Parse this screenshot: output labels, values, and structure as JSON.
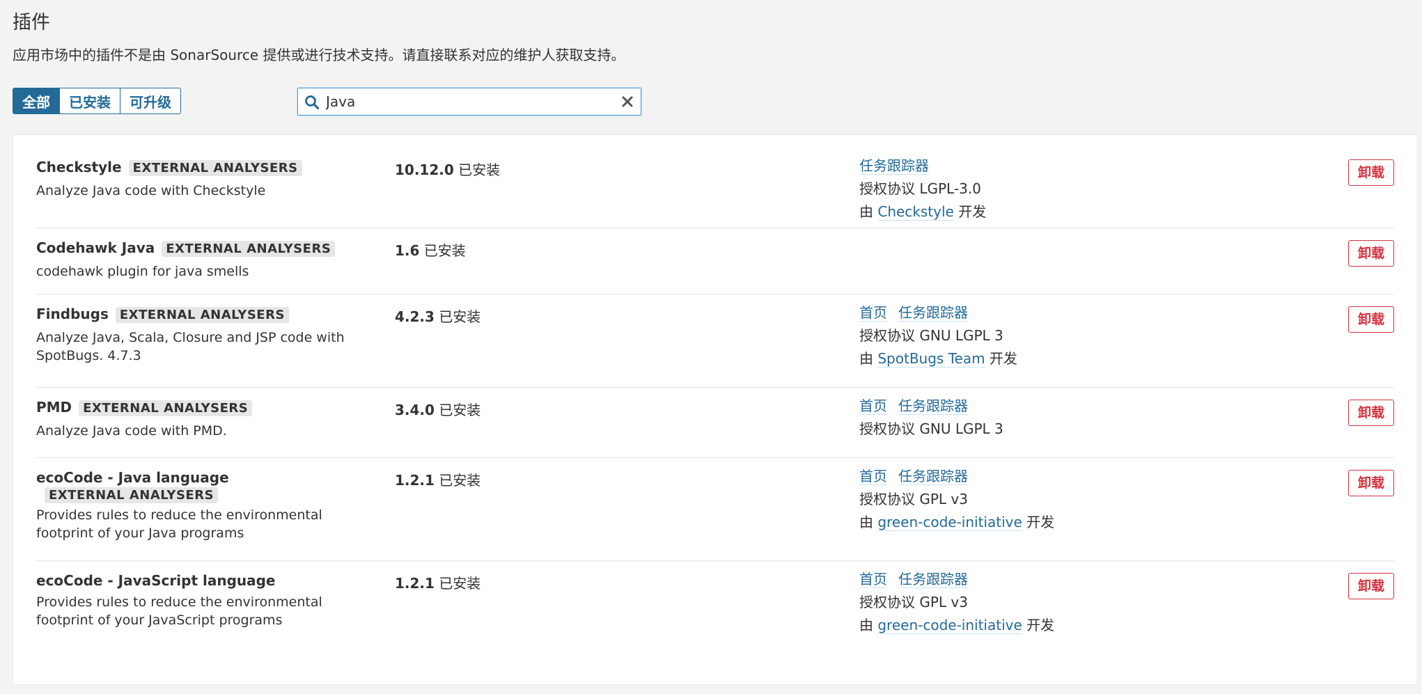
{
  "header": {
    "title": "插件",
    "notice": "应用市场中的插件不是由 SonarSource 提供或进行技术支持。请直接联系对应的维护人获取支持。"
  },
  "filters": {
    "all": "全部",
    "installed": "已安装",
    "updates": "可升级",
    "active": "all"
  },
  "search": {
    "value": "Java",
    "icon": "search-icon",
    "clear_icon": "close-icon"
  },
  "labels": {
    "installed_suffix": "已安装",
    "homepage": "首页",
    "issue_tracker": "任务跟踪器",
    "license_prefix": "授权协议",
    "developed_by_prefix": "由",
    "developed_by_suffix": "开发",
    "uninstall": "卸载"
  },
  "plugins": [
    {
      "name": "Checkstyle",
      "category": "EXTERNAL ANALYSERS",
      "description": "Analyze Java code with Checkstyle",
      "version": "10.12.0",
      "license": "LGPL-3.0",
      "organization": "Checkstyle"
    },
    {
      "name": "Codehawk Java",
      "category": "EXTERNAL ANALYSERS",
      "description": "codehawk plugin for java smells",
      "version": "1.6"
    },
    {
      "name": "Findbugs",
      "category": "EXTERNAL ANALYSERS",
      "description": "Analyze Java, Scala, Closure and JSP code with SpotBugs. 4.7.3",
      "version": "4.2.3",
      "license": "GNU LGPL 3",
      "organization": "SpotBugs Team"
    },
    {
      "name": "PMD",
      "category": "EXTERNAL ANALYSERS",
      "description": "Analyze Java code with PMD.",
      "version": "3.4.0",
      "license": "GNU LGPL 3"
    },
    {
      "name": "ecoCode - Java language",
      "category": "EXTERNAL ANALYSERS",
      "description": "Provides rules to reduce the environmental footprint of your Java programs",
      "version": "1.2.1",
      "license": "GPL v3",
      "organization": "green-code-initiative"
    },
    {
      "name": "ecoCode - JavaScript language",
      "description": "Provides rules to reduce the environmental footprint of your JavaScript programs",
      "version": "1.2.1",
      "license": "GPL v3",
      "organization": "green-code-initiative"
    }
  ],
  "colors": {
    "accent": "#236a97",
    "danger": "#d4333f",
    "badge_bg": "#e6e6e6",
    "page_bg": "#f3f3f3"
  }
}
